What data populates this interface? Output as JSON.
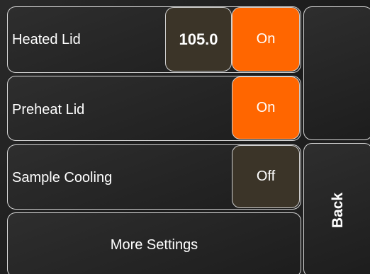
{
  "rows": {
    "heated_lid": {
      "label": "Heated Lid",
      "value": "105.0",
      "toggle": "On"
    },
    "preheat_lid": {
      "label": "Preheat Lid",
      "toggle": "On"
    },
    "sample_cooling": {
      "label": "Sample Cooling",
      "toggle": "Off"
    }
  },
  "more_settings_label": "More Settings",
  "back_label": "Back",
  "colors": {
    "on": "#ff6600",
    "off": "#3b3428",
    "border": "#d6d6d6"
  }
}
